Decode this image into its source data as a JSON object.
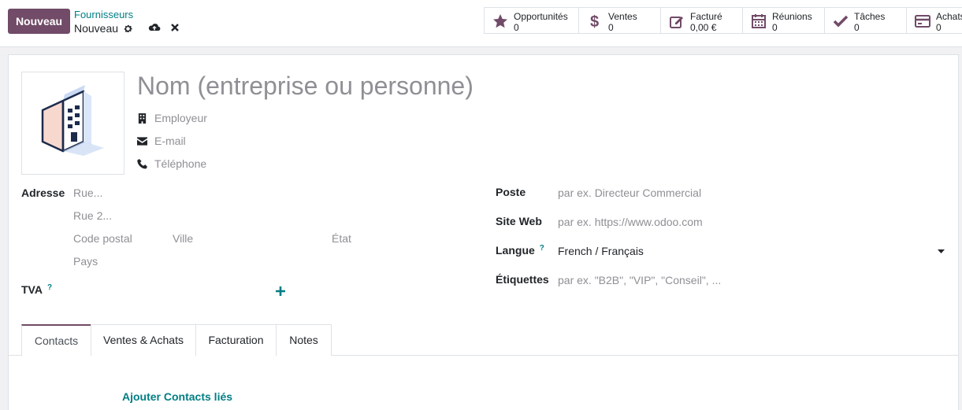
{
  "control_panel": {
    "new_button": "Nouveau",
    "breadcrumb_parent": "Fournisseurs",
    "breadcrumb_current": "Nouveau"
  },
  "smart_buttons": [
    {
      "label": "Opportunités",
      "value": "0",
      "icon": "star-icon"
    },
    {
      "label": "Ventes",
      "value": "0",
      "icon": "dollar-icon"
    },
    {
      "label": "Facturé",
      "value": "0,00 €",
      "icon": "invoice-edit-icon"
    },
    {
      "label": "Réunions",
      "value": "0",
      "icon": "calendar-icon"
    },
    {
      "label": "Tâches",
      "value": "0",
      "icon": "check-icon"
    },
    {
      "label": "Achats",
      "value": "0",
      "icon": "credit-card-icon"
    }
  ],
  "form": {
    "name_placeholder": "Nom (entreprise ou personne)",
    "employer_placeholder": "Employeur",
    "email_placeholder": "E-mail",
    "phone_placeholder": "Téléphone",
    "address_label": "Adresse",
    "street_placeholder": "Rue...",
    "street2_placeholder": "Rue 2...",
    "zip_placeholder": "Code postal",
    "city_placeholder": "Ville",
    "state_placeholder": "État",
    "country_placeholder": "Pays",
    "vat_label": "TVA",
    "help_mark": "?",
    "job_label": "Poste",
    "job_placeholder": "par ex. Directeur Commercial",
    "website_label": "Site Web",
    "website_placeholder": "par ex. https://www.odoo.com",
    "lang_label": "Langue",
    "lang_value": "French / Français",
    "tags_label": "Étiquettes",
    "tags_placeholder": "par ex. \"B2B\", \"VIP\", \"Conseil\", ..."
  },
  "tabs": [
    "Contacts",
    "Ventes & Achats",
    "Facturation",
    "Notes"
  ],
  "contacts_tab": {
    "add_link": "Ajouter Contacts liés"
  },
  "colors": {
    "primary": "#714b67",
    "link": "#017e84",
    "placeholder": "#8f8f95"
  }
}
